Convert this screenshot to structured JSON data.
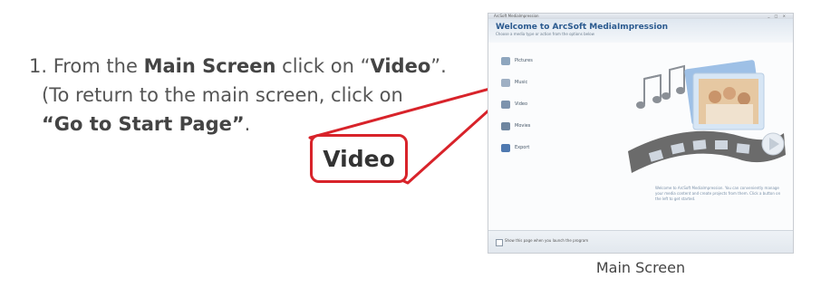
{
  "instructions": {
    "line1": {
      "pre": "1. From the ",
      "bold1": "Main Screen",
      "mid": " click on “",
      "bold2": "Video",
      "post": "”."
    },
    "line2": "(To return to the main screen, click on",
    "line3": {
      "bold": "“Go to Start Page”",
      "post": "."
    }
  },
  "callout": {
    "label": "Video",
    "color": "#d8232a"
  },
  "screenshot": {
    "window_title": "ArcSoft MediaImpression",
    "header_title": "Welcome to ArcSoft MediaImpression",
    "header_subtitle": "Choose a media type or action from the options below",
    "menu_items": [
      "Pictures",
      "Music",
      "Video",
      "Movies",
      "Export"
    ],
    "description": "Welcome to ArcSoft MediaImpression. You can conveniently manage your media content and create projects from them. Click a button on the left to get started.",
    "footer_checkbox": "Show this page when you launch the program"
  },
  "caption": "Main Screen"
}
